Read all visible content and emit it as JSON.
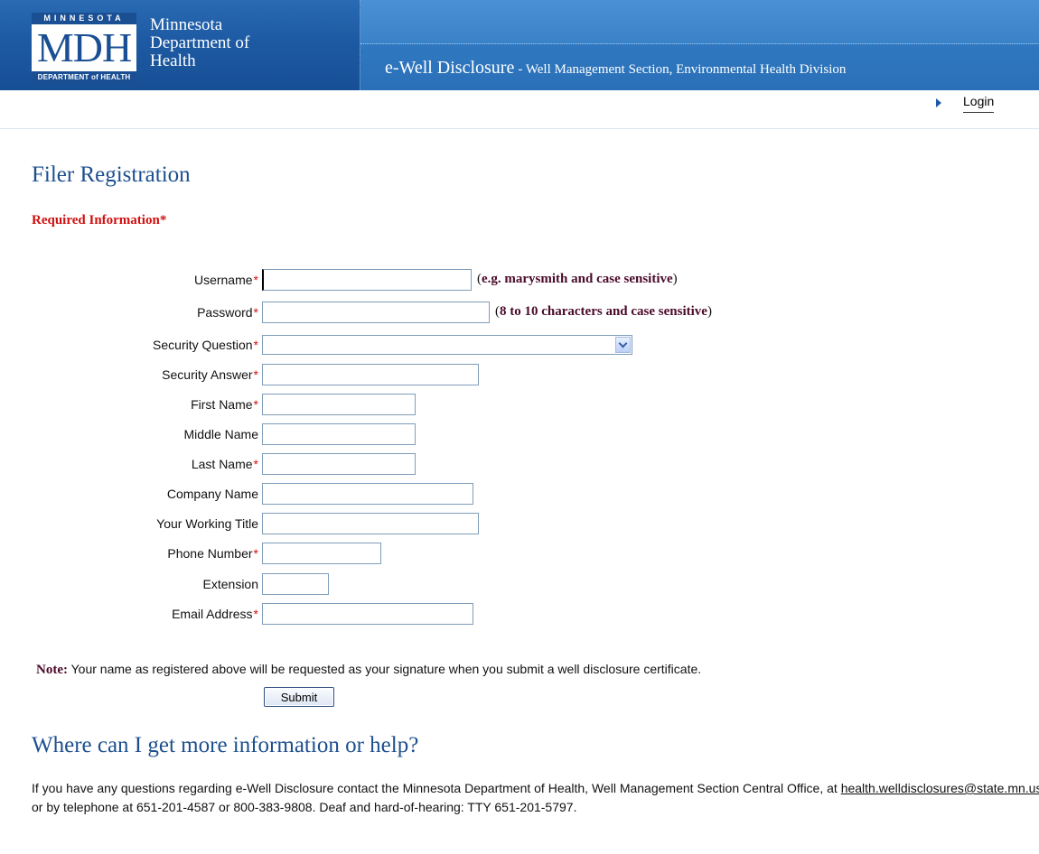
{
  "header": {
    "logo": {
      "top_text": "MINNESOTA",
      "main_text": "MDH",
      "bottom_text": "DEPARTMENT of HEALTH"
    },
    "org_name_lines": [
      "Minnesota",
      "Department of",
      "Health"
    ],
    "app_title": "e-Well Disclosure",
    "app_subtitle": "- Well Management Section, Environmental Health Division"
  },
  "nav": {
    "login_label": "Login"
  },
  "page": {
    "title": "Filer Registration",
    "required_label": "Required Information",
    "required_marker": "*"
  },
  "form": {
    "fields": [
      {
        "label": "Username",
        "required": true,
        "value": "",
        "hint": "(e.g. marysmith and case sensitive)"
      },
      {
        "label": "Password",
        "required": true,
        "value": "",
        "hint": "(8 to 10 characters and case sensitive)"
      },
      {
        "label": "Security Question",
        "required": true,
        "value": ""
      },
      {
        "label": "Security Answer",
        "required": true,
        "value": ""
      },
      {
        "label": "First Name",
        "required": true,
        "value": ""
      },
      {
        "label": "Middle Name",
        "required": false,
        "value": ""
      },
      {
        "label": "Last Name",
        "required": true,
        "value": ""
      },
      {
        "label": "Company Name",
        "required": false,
        "value": ""
      },
      {
        "label": "Your Working Title",
        "required": false,
        "value": ""
      },
      {
        "label": "Phone Number",
        "required": true,
        "value": ""
      },
      {
        "label": "Extension",
        "required": false,
        "value": ""
      },
      {
        "label": "Email Address",
        "required": true,
        "value": ""
      }
    ],
    "note_label": "Note:",
    "note_text": "Your name as registered above will be requested as your signature when you submit a well disclosure certificate.",
    "submit_label": "Submit"
  },
  "help": {
    "title": "Where can I get more information or help?",
    "text_before": "If you have any questions regarding e-Well Disclosure contact the Minnesota Department of Health, Well Management Section Central Office, at ",
    "email": "health.welldisclosures@state.mn.us",
    "text_after": " or by telephone at 651-201-4587 or 800-383-9808. Deaf and hard-of-hearing: TTY 651-201-5797."
  },
  "colors": {
    "header_blue": "#1d5aa3",
    "title_blue": "#1d4f8f",
    "required_red": "#d01010",
    "hint_maroon": "#4a0a2a"
  }
}
